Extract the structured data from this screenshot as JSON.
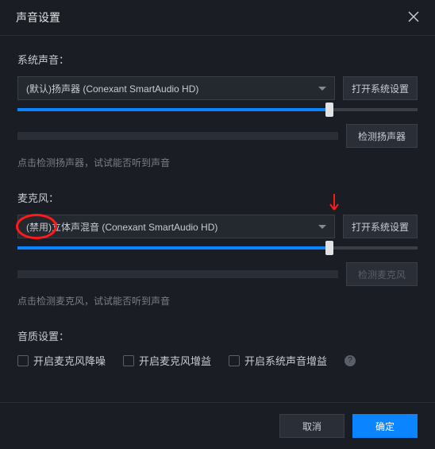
{
  "header": {
    "title": "声音设置"
  },
  "system_sound": {
    "label": "系统声音：",
    "select_value": "(默认)扬声器 (Conexant SmartAudio HD)",
    "open_settings": "打开系统设置",
    "test_speaker": "检测扬声器",
    "hint": "点击检测扬声器，试试能否听到声音",
    "slider_percent": 78
  },
  "microphone": {
    "label": "麦克风：",
    "select_value": "(禁用)立体声混音 (Conexant SmartAudio HD)",
    "open_settings": "打开系统设置",
    "test_mic": "检测麦克风",
    "hint": "点击检测麦克风，试试能否听到声音",
    "slider_percent": 78
  },
  "quality": {
    "label": "音质设置：",
    "noise_reduce": "开启麦克风降噪",
    "mic_gain": "开启麦克风增益",
    "sys_gain": "开启系统声音增益"
  },
  "footer": {
    "cancel": "取消",
    "ok": "确定"
  }
}
